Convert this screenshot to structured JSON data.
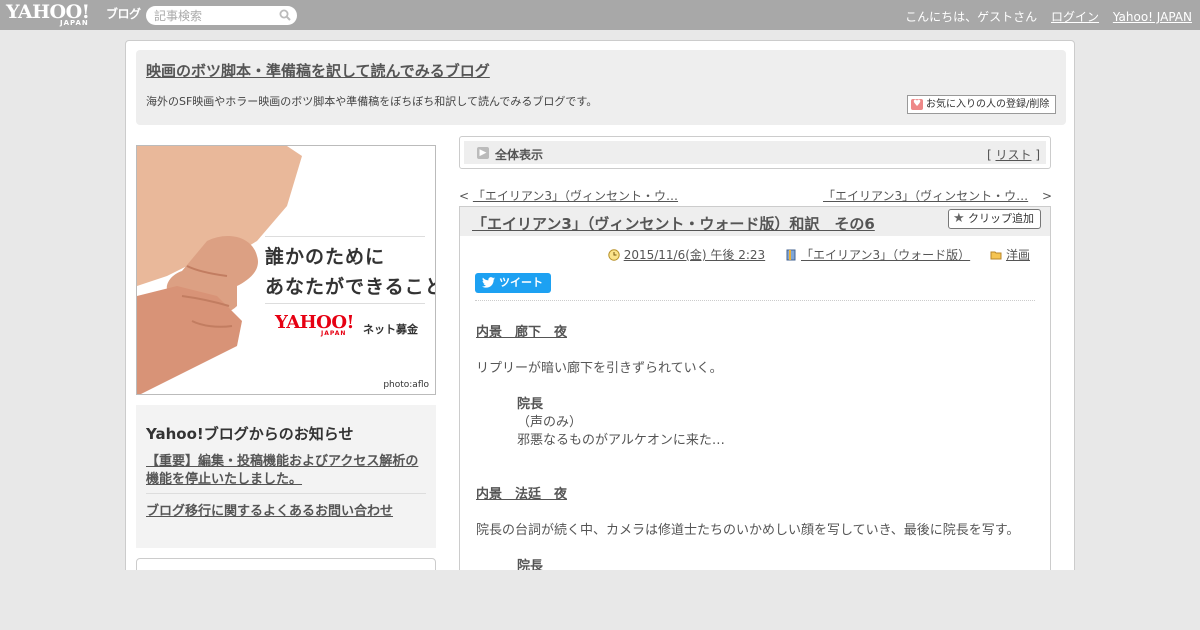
{
  "topbar": {
    "logo_main": "YAHOO!",
    "logo_sub": "JAPAN",
    "logo_blog": "ブログ",
    "search_placeholder": "記事検索",
    "greeting": "こんにちは、ゲストさん",
    "login": "ログイン",
    "yahoo_japan": "Yahoo! JAPAN"
  },
  "header": {
    "title": "映画のボツ脚本・準備稿を訳して読んでみるブログ",
    "description": "海外のSF映画やホラー映画のボツ脚本や準備稿をぼちぼち和訳して読んでみるブログです。",
    "favorite_button": "お気に入りの人の登録/削除"
  },
  "banner": {
    "line1": "誰かのために",
    "line2": "あなたができること",
    "logo_main": "YAHOO!",
    "logo_sub": "JAPAN",
    "logo_service": "ネット募金",
    "credit": "photo:aflo"
  },
  "notices": {
    "heading": "Yahoo!ブログからのお知らせ",
    "items": [
      "【重要】編集・投稿機能およびアクセス解析の機能を停止いたしました。",
      "ブログ移行に関するよくあるお問い合わせ"
    ]
  },
  "view": {
    "label": "全体表示",
    "list_link": "リスト"
  },
  "nav": {
    "prev": "「エイリアン3」（ヴィンセント・ウ…",
    "next": "「エイリアン3」（ヴィンセント・ウ…"
  },
  "post": {
    "title": "「エイリアン3」（ヴィンセント・ウォード版）和訳　その6",
    "clip_button": "クリップ追加",
    "date": "2015/11/6(金) 午後 2:23",
    "category": "「エイリアン3」（ウォード版）",
    "folder": "洋画",
    "tweet": "ツイート",
    "lines": [
      "内景　廊下　夜",
      "リプリーが暗い廊下を引きずられていく。",
      "院長",
      "（声のみ）",
      "邪悪なるものがアルケオンに来た…",
      "内景　法廷　夜",
      "院長の台詞が続く中、カメラは修道士たちのいかめしい顔を写していき、最後に院長を写す。",
      "院長"
    ]
  },
  "colors": {
    "topbar": "#a8a8a8",
    "tweet": "#1da1f2",
    "page_background": "#e8e8e8"
  }
}
